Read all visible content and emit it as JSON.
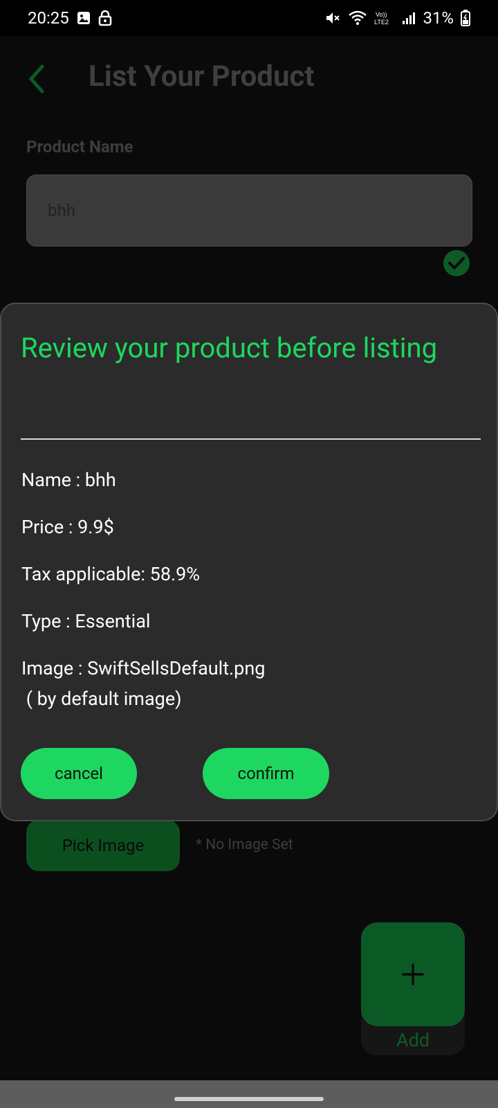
{
  "status_bar": {
    "time": "20:25",
    "battery": "31%",
    "icons": [
      "image-icon",
      "lock-icon",
      "mute-icon",
      "wifi-icon",
      "volte-icon",
      "signal-icon",
      "battery-icon"
    ]
  },
  "header": {
    "title": "List Your Product",
    "back_icon": "back-arrow-icon"
  },
  "form": {
    "product_name_label": "Product Name",
    "product_name_value": "bhh",
    "valid_icon": "check-circle-icon",
    "pick_image_label": "Pick Image",
    "no_image_note": "* No Image Set",
    "add_label": "Add",
    "add_icon": "plus-icon"
  },
  "dialog": {
    "title": "Review your product before listing",
    "name_line": "Name : bhh",
    "price_line": "Price : 9.9$",
    "tax_line": "Tax applicable: 58.9%",
    "type_line": "Type : Essential",
    "image_line": "Image : SwiftSellsDefault.png",
    "image_note": " ( by default image)",
    "cancel_label": "cancel",
    "confirm_label": "confirm"
  },
  "colors": {
    "accent": "#1ed760",
    "dim_accent": "#0b5a26",
    "dialog_bg": "#2b2b2b",
    "background": "#0a0a0a"
  }
}
